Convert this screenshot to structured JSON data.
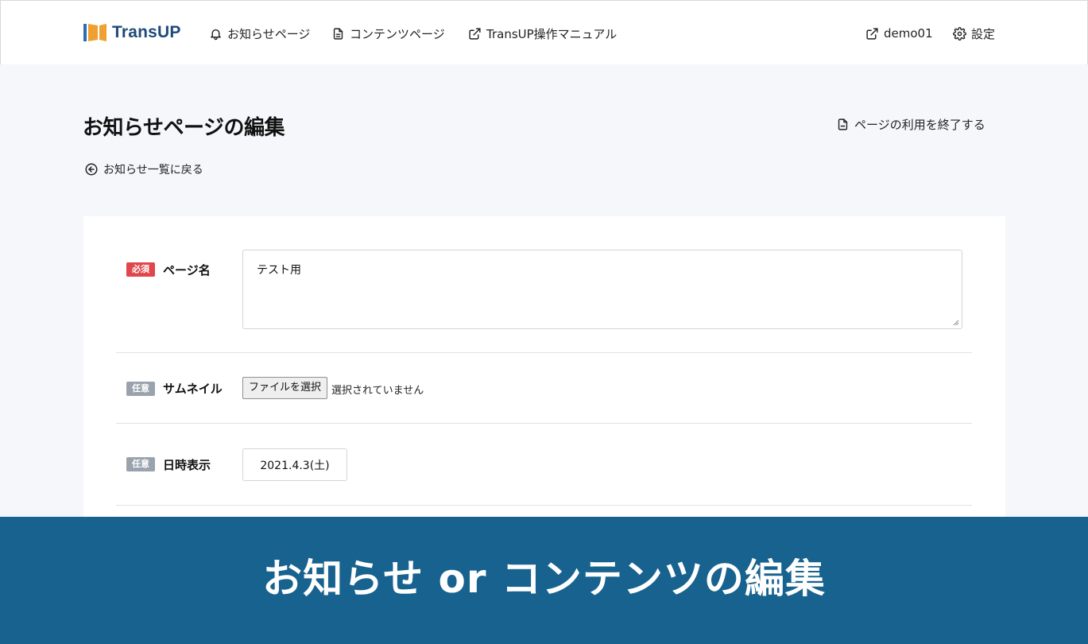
{
  "header": {
    "logo_text": "TransUP",
    "nav": [
      {
        "label": "お知らせページ",
        "icon": "bell-icon"
      },
      {
        "label": "コンテンツページ",
        "icon": "document-icon"
      },
      {
        "label": "TransUP操作マニュアル",
        "icon": "external-link-icon"
      }
    ],
    "user": {
      "label": "demo01",
      "icon": "external-link-icon"
    },
    "settings": {
      "label": "設定",
      "icon": "gear-icon"
    }
  },
  "page": {
    "title": "お知らせページの編集",
    "end_link": "ページの利用を終了する",
    "back_link": "お知らせ一覧に戻る"
  },
  "form": {
    "page_name": {
      "badge": "必須",
      "label": "ページ名",
      "value": "テスト用"
    },
    "thumbnail": {
      "badge": "任意",
      "label": "サムネイル",
      "button": "ファイルを選択",
      "status": "選択されていません"
    },
    "datetime": {
      "badge": "任意",
      "label": "日時表示",
      "value": "2021.4.3(土)"
    }
  },
  "banner": {
    "text": "お知らせ or コンテンツの編集"
  },
  "colors": {
    "accent": "#17628f",
    "required": "#e0464b",
    "optional": "#9aa3ad",
    "logo_orange": "#f0a030",
    "logo_blue": "#2a6fb0"
  }
}
